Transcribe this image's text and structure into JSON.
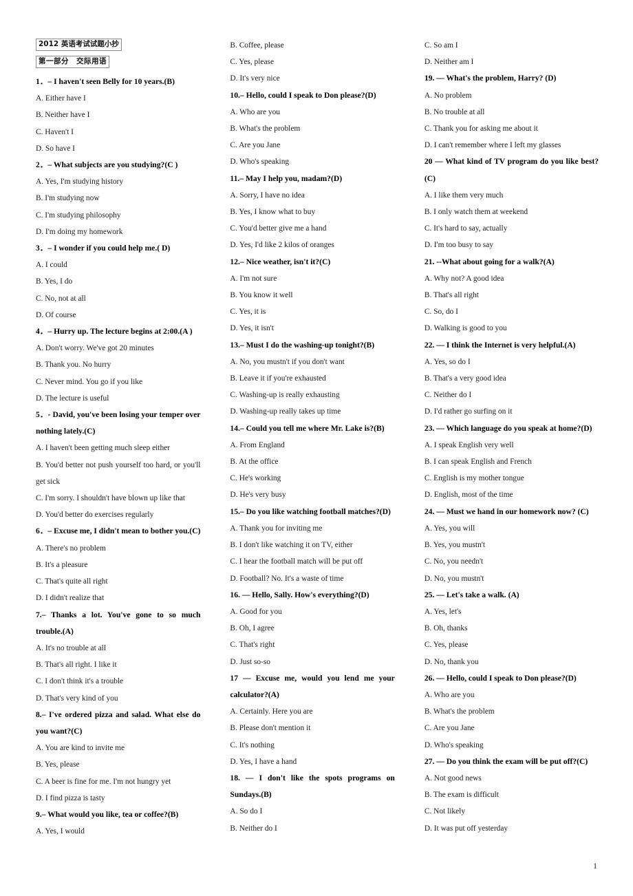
{
  "document": {
    "title_box_1": "2012 英语考试试题小抄",
    "title_box_2": "第一部分　交际用语",
    "page_number": "1"
  },
  "columns": [
    {
      "id": "column-1",
      "blocks": [
        {
          "type": "question",
          "text": "1．– I haven't seen Belly for 10 years.(B)",
          "wrap": false
        },
        {
          "type": "option",
          "text": "A. Either have I"
        },
        {
          "type": "option",
          "text": "B. Neither have I"
        },
        {
          "type": "option",
          "text": "C. Haven't I"
        },
        {
          "type": "option",
          "text": "D. So have I"
        },
        {
          "type": "question",
          "text": "2．– What subjects are you studying?(C )",
          "wrap": false
        },
        {
          "type": "option",
          "text": "A. Yes, I'm studying history"
        },
        {
          "type": "option",
          "text": "B. I'm studying now"
        },
        {
          "type": "option",
          "text": "C. I'm studying philosophy"
        },
        {
          "type": "option",
          "text": "D. I'm doing my homework"
        },
        {
          "type": "question",
          "text": "3．– I wonder if you could help me.( D)",
          "wrap": false
        },
        {
          "type": "option",
          "text": "A. I could"
        },
        {
          "type": "option",
          "text": "B. Yes, I do"
        },
        {
          "type": "option",
          "text": "C. No, not at all"
        },
        {
          "type": "option",
          "text": "D. Of course"
        },
        {
          "type": "question",
          "text": "4．– Hurry up. The lecture begins at 2:00.(A )",
          "wrap": false
        },
        {
          "type": "option",
          "text": "A. Don't worry. We've got 20 minutes"
        },
        {
          "type": "option",
          "text": "B. Thank you. No hurry"
        },
        {
          "type": "option",
          "text": "C. Never mind. You go if you like"
        },
        {
          "type": "option",
          "text": "D. The lecture is useful"
        },
        {
          "type": "question",
          "text": "5．- David, you've been losing your temper over nothing lately.(C)",
          "wrap": true
        },
        {
          "type": "option",
          "text": "A. I haven't been getting much sleep either"
        },
        {
          "type": "option",
          "text": "B. You'd better not push yourself too hard, or you'll get sick",
          "wrap": true
        },
        {
          "type": "option",
          "text": "C. I'm sorry. I shouldn't have blown up like that"
        },
        {
          "type": "option",
          "text": "D. You'd better do exercises regularly"
        },
        {
          "type": "question",
          "text": "6．– Excuse me, I didn't mean to bother you.(C)",
          "wrap": false
        },
        {
          "type": "option",
          "text": "A. There's no problem"
        },
        {
          "type": "option",
          "text": "B. It's a pleasure"
        },
        {
          "type": "option",
          "text": "C. That's quite all right"
        },
        {
          "type": "option",
          "text": "D. I didn't realize that"
        },
        {
          "type": "question",
          "text": "7.– Thanks a lot. You've gone to so much trouble.(A)",
          "wrap": true
        },
        {
          "type": "option",
          "text": "A. It's no trouble at all"
        },
        {
          "type": "option",
          "text": "B. That's all right. I like it"
        },
        {
          "type": "option",
          "text": "C. I don't think it's a trouble"
        },
        {
          "type": "option",
          "text": "D. That's very kind of you"
        },
        {
          "type": "question",
          "text": "8.– I've ordered pizza and salad. What else do you want?(C)",
          "wrap": true
        },
        {
          "type": "option",
          "text": "A. You are kind to invite me"
        },
        {
          "type": "option",
          "text": "B. Yes, please"
        },
        {
          "type": "option",
          "text": "C. A beer is fine for me. I'm not hungry yet"
        },
        {
          "type": "option",
          "text": "D. I find pizza is tasty"
        },
        {
          "type": "question",
          "text": "9.– What would you like, tea or coffee?(B)",
          "wrap": false
        },
        {
          "type": "option",
          "text": "A. Yes, I would"
        }
      ]
    },
    {
      "id": "column-2",
      "blocks": [
        {
          "type": "option",
          "text": "B. Coffee, please"
        },
        {
          "type": "option",
          "text": "C. Yes, please"
        },
        {
          "type": "option",
          "text": "D. It's very nice"
        },
        {
          "type": "question",
          "text": "10.– Hello, could I speak to Don please?(D)",
          "wrap": false
        },
        {
          "type": "option",
          "text": "A. Who are you"
        },
        {
          "type": "option",
          "text": "B. What's the problem"
        },
        {
          "type": "option",
          "text": "C. Are you Jane"
        },
        {
          "type": "option",
          "text": "D. Who's speaking"
        },
        {
          "type": "question",
          "text": "11.– May I help you, madam?(D)",
          "wrap": false
        },
        {
          "type": "option",
          "text": "A. Sorry, I have no idea"
        },
        {
          "type": "option",
          "text": "B. Yes, I know what to buy"
        },
        {
          "type": "option",
          "text": "C. You'd better give me a hand"
        },
        {
          "type": "option",
          "text": "D. Yes, I'd like 2 kilos of oranges"
        },
        {
          "type": "question",
          "text": "12.– Nice weather, isn't it?(C)",
          "wrap": false
        },
        {
          "type": "option",
          "text": "A. I'm not sure"
        },
        {
          "type": "option",
          "text": "B. You know it well"
        },
        {
          "type": "option",
          "text": "C. Yes, it is"
        },
        {
          "type": "option",
          "text": "D. Yes, it isn't"
        },
        {
          "type": "question",
          "text": "13.– Must I do the washing-up tonight?(B)",
          "wrap": false
        },
        {
          "type": "option",
          "text": "A. No, you mustn't if you don't want"
        },
        {
          "type": "option",
          "text": "B. Leave it if you're exhausted"
        },
        {
          "type": "option",
          "text": "C. Washing-up is really exhausting"
        },
        {
          "type": "option",
          "text": "D. Washing-up really takes up time"
        },
        {
          "type": "question",
          "text": "14.– Could you tell me where Mr. Lake is?(B)",
          "wrap": false
        },
        {
          "type": "option",
          "text": "A. From England"
        },
        {
          "type": "option",
          "text": "B. At the office"
        },
        {
          "type": "option",
          "text": "C. He's working"
        },
        {
          "type": "option",
          "text": "D. He's very busy"
        },
        {
          "type": "question",
          "text": "15.– Do you like watching football matches?(D)",
          "wrap": false
        },
        {
          "type": "option",
          "text": "A. Thank you for inviting me"
        },
        {
          "type": "option",
          "text": "B. I don't like watching it on TV, either"
        },
        {
          "type": "option",
          "text": "C. I hear the football match will be put off"
        },
        {
          "type": "option",
          "text": "D. Football? No. It's a waste of time"
        },
        {
          "type": "question",
          "text": "16. — Hello, Sally. How's everything?(D)",
          "wrap": false
        },
        {
          "type": "option",
          "text": "A. Good for you"
        },
        {
          "type": "option",
          "text": "B. Oh, I agree"
        },
        {
          "type": "option",
          "text": "C. That's right"
        },
        {
          "type": "option",
          "text": "D. Just so-so"
        },
        {
          "type": "question",
          "text": "17 — Excuse me, would you lend me your calculator?(A)",
          "wrap": true
        },
        {
          "type": "option",
          "text": "A. Certainly. Here you are"
        },
        {
          "type": "option",
          "text": "B. Please don't mention it"
        },
        {
          "type": "option",
          "text": "C. It's nothing"
        },
        {
          "type": "option",
          "text": "D. Yes, I have a hand"
        },
        {
          "type": "question",
          "text": "18. — I don't like the spots programs on Sundays.(B)",
          "wrap": true
        },
        {
          "type": "option",
          "text": "A. So do I"
        },
        {
          "type": "option",
          "text": "B. Neither do I"
        }
      ]
    },
    {
      "id": "column-3",
      "blocks": [
        {
          "type": "option",
          "text": "C. So am I"
        },
        {
          "type": "option",
          "text": "D. Neither am I"
        },
        {
          "type": "question",
          "text": "19. — What's the problem, Harry? (D)",
          "wrap": false
        },
        {
          "type": "option",
          "text": "A. No problem"
        },
        {
          "type": "option",
          "text": "B. No trouble at all"
        },
        {
          "type": "option",
          "text": "C. Thank you for asking me about it"
        },
        {
          "type": "option",
          "text": "D. I can't remember where I left my glasses"
        },
        {
          "type": "question",
          "text": "20 — What kind of TV program do you like best?(C)",
          "wrap": true
        },
        {
          "type": "option",
          "text": "A. I like them very much"
        },
        {
          "type": "option",
          "text": "B. I only watch them at weekend"
        },
        {
          "type": "option",
          "text": "C. It's hard to say, actually"
        },
        {
          "type": "option",
          "text": "D. I'm too busy to say"
        },
        {
          "type": "question",
          "text": "21. --What about going for a walk?(A)",
          "wrap": false
        },
        {
          "type": "option",
          "text": "A. Why not? A good idea"
        },
        {
          "type": "option",
          "text": "B. That's all right"
        },
        {
          "type": "option",
          "text": "C. So, do I"
        },
        {
          "type": "option",
          "text": "D. Walking is good to you"
        },
        {
          "type": "question",
          "text": "22. — I think the Internet is very helpful.(A)",
          "wrap": false
        },
        {
          "type": "option",
          "text": "A. Yes, so do I"
        },
        {
          "type": "option",
          "text": "B. That's a very good idea"
        },
        {
          "type": "option",
          "text": "C. Neither do I"
        },
        {
          "type": "option",
          "text": "D. I'd rather go surfing on it"
        },
        {
          "type": "question",
          "text": "23. — Which language do you speak at home?(D)",
          "wrap": false
        },
        {
          "type": "option",
          "text": "A. I speak English very well"
        },
        {
          "type": "option",
          "text": "B. I can speak English and French"
        },
        {
          "type": "option",
          "text": "C. English is my mother tongue"
        },
        {
          "type": "option",
          "text": "D. English, most of the time"
        },
        {
          "type": "question",
          "text": "24. — Must we hand in our homework now? (C)",
          "wrap": false
        },
        {
          "type": "option",
          "text": "A. Yes, you will"
        },
        {
          "type": "option",
          "text": "B. Yes, you mustn't"
        },
        {
          "type": "option",
          "text": "C. No, you needn't"
        },
        {
          "type": "option",
          "text": "D. No, you mustn't"
        },
        {
          "type": "question",
          "text": "25. — Let's take a walk. (A)",
          "wrap": false
        },
        {
          "type": "option",
          "text": "A. Yes, let's"
        },
        {
          "type": "option",
          "text": "B. Oh, thanks"
        },
        {
          "type": "option",
          "text": "C. Yes, please"
        },
        {
          "type": "option",
          "text": "D. No, thank you"
        },
        {
          "type": "question",
          "text": "26. — Hello, could I speak to Don please?(D)",
          "wrap": false
        },
        {
          "type": "option",
          "text": "A. Who are you"
        },
        {
          "type": "option",
          "text": "B. What's the problem"
        },
        {
          "type": "option",
          "text": "C. Are you Jane"
        },
        {
          "type": "option",
          "text": "D. Who's speaking"
        },
        {
          "type": "question",
          "text": "27. — Do you think the exam will be put off?(C)",
          "wrap": false
        },
        {
          "type": "option",
          "text": "A. Not good news"
        },
        {
          "type": "option",
          "text": "B. The exam is difficult"
        },
        {
          "type": "option",
          "text": "C. Not likely"
        },
        {
          "type": "option",
          "text": "D. It was put off yesterday"
        }
      ]
    }
  ]
}
